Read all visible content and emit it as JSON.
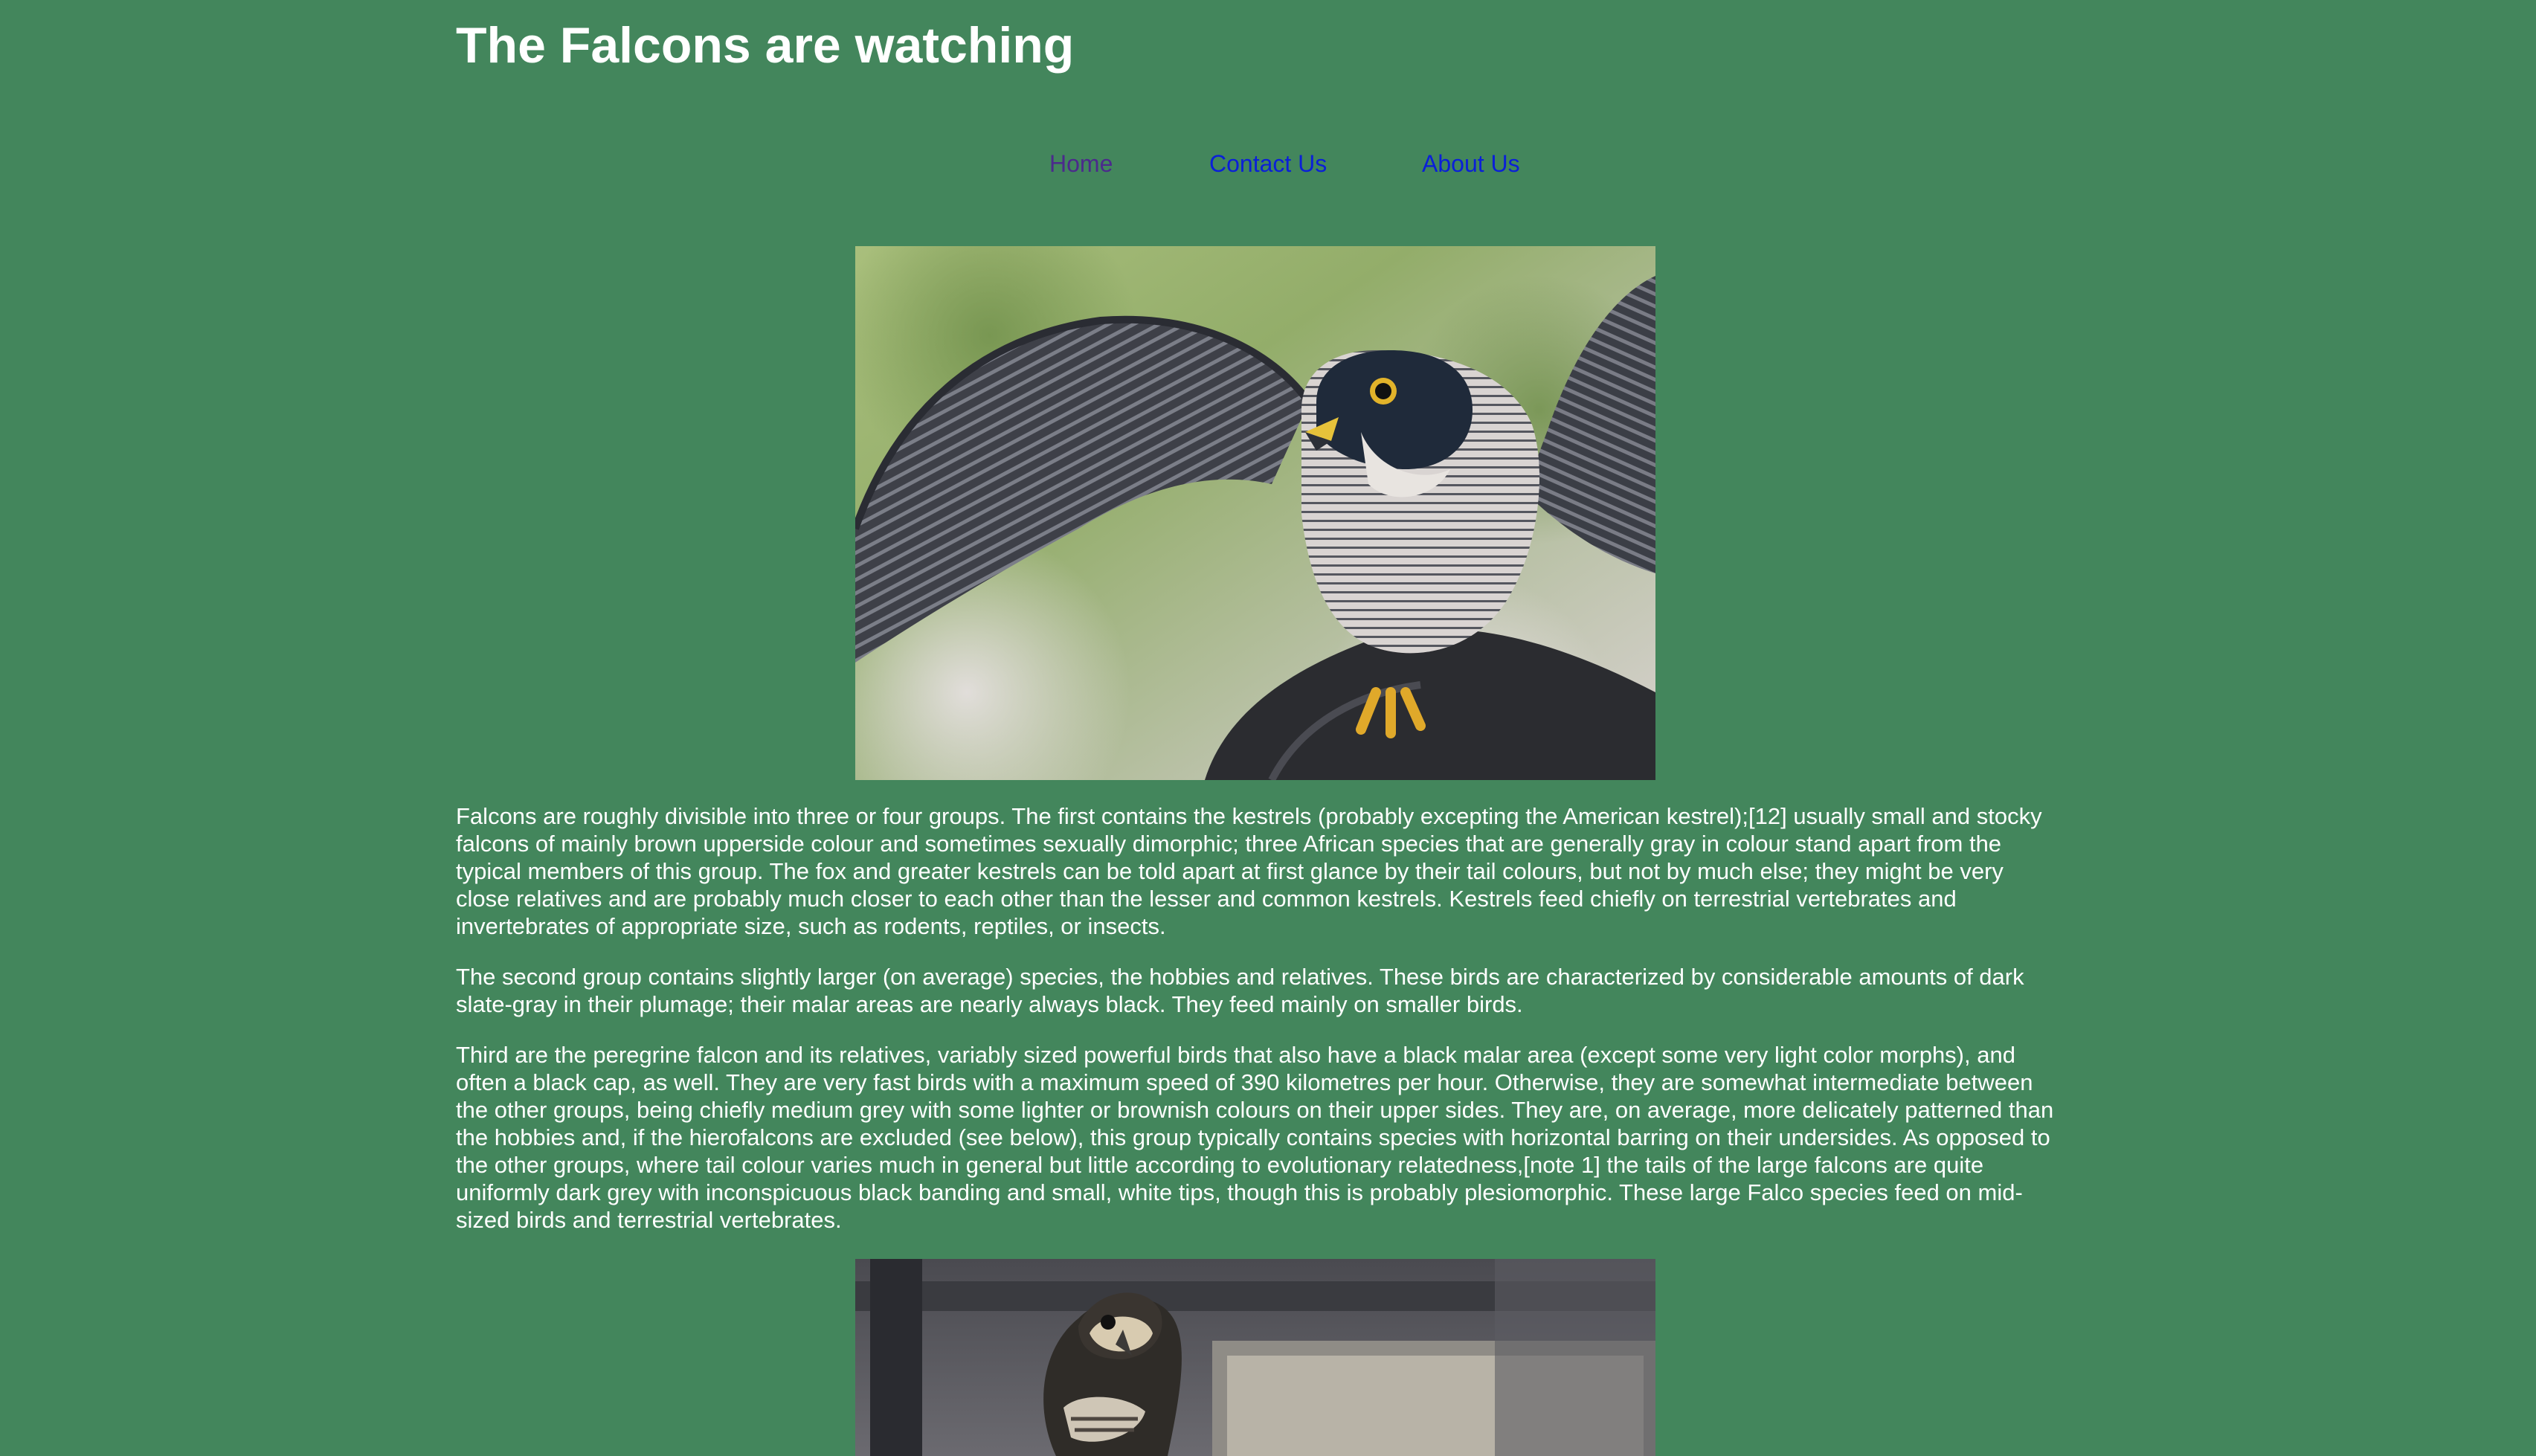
{
  "header": {
    "title": "The Falcons are watching"
  },
  "nav": {
    "items": [
      {
        "label": "Home"
      },
      {
        "label": "Contact Us"
      },
      {
        "label": "About Us"
      }
    ]
  },
  "images": {
    "hero_icon": "falcon-photo",
    "second_icon": "falcon-photo"
  },
  "article": {
    "paragraphs": [
      "Falcons are roughly divisible into three or four groups. The first contains the kestrels (probably excepting the American kestrel);[12] usually small and stocky falcons of mainly brown upperside colour and sometimes sexually dimorphic; three African species that are generally gray in colour stand apart from the typical members of this group. The fox and greater kestrels can be told apart at first glance by their tail colours, but not by much else; they might be very close relatives and are probably much closer to each other than the lesser and common kestrels. Kestrels feed chiefly on terrestrial vertebrates and invertebrates of appropriate size, such as rodents, reptiles, or insects.",
      "The second group contains slightly larger (on average) species, the hobbies and relatives. These birds are characterized by considerable amounts of dark slate-gray in their plumage; their malar areas are nearly always black. They feed mainly on smaller birds.",
      "Third are the peregrine falcon and its relatives, variably sized powerful birds that also have a black malar area (except some very light color morphs), and often a black cap, as well. They are very fast birds with a maximum speed of 390 kilometres per hour. Otherwise, they are somewhat intermediate between the other groups, being chiefly medium grey with some lighter or brownish colours on their upper sides. They are, on average, more delicately patterned than the hobbies and, if the hierofalcons are excluded (see below), this group typically contains species with horizontal barring on their undersides. As opposed to the other groups, where tail colour varies much in general but little according to evolutionary relatedness,[note 1] the tails of the large falcons are quite uniformly dark grey with inconspicuous black banding and small, white tips, though this is probably plesiomorphic. These large Falco species feed on mid-sized birds and terrestrial vertebrates."
    ]
  },
  "colors": {
    "background": "#43865c",
    "text": "#ffffff",
    "link": "#0a1fd8",
    "visited_link": "#4b2a8c"
  }
}
